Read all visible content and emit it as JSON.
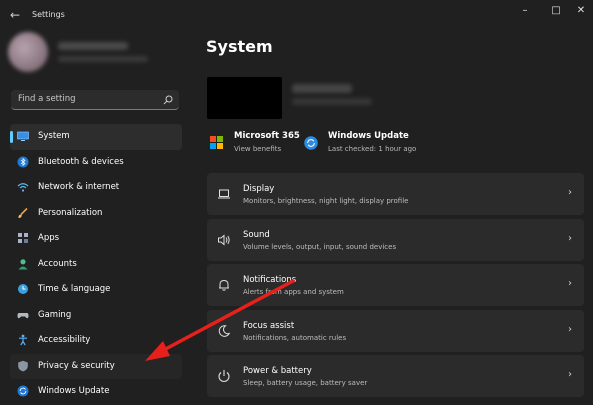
{
  "app": {
    "title": "Settings"
  },
  "search": {
    "placeholder": "Find a setting"
  },
  "sidebar": {
    "items": [
      {
        "label": "System"
      },
      {
        "label": "Bluetooth & devices"
      },
      {
        "label": "Network & internet"
      },
      {
        "label": "Personalization"
      },
      {
        "label": "Apps"
      },
      {
        "label": "Accounts"
      },
      {
        "label": "Time & language"
      },
      {
        "label": "Gaming"
      },
      {
        "label": "Accessibility"
      },
      {
        "label": "Privacy & security"
      },
      {
        "label": "Windows Update"
      }
    ]
  },
  "main": {
    "title": "System",
    "quick_links": [
      {
        "title": "Microsoft 365",
        "subtitle": "View benefits"
      },
      {
        "title": "Windows Update",
        "subtitle": "Last checked: 1 hour ago"
      }
    ],
    "cards": [
      {
        "title": "Display",
        "subtitle": "Monitors, brightness, night light, display profile"
      },
      {
        "title": "Sound",
        "subtitle": "Volume levels, output, input, sound devices"
      },
      {
        "title": "Notifications",
        "subtitle": "Alerts from apps and system"
      },
      {
        "title": "Focus assist",
        "subtitle": "Notifications, automatic rules"
      },
      {
        "title": "Power & battery",
        "subtitle": "Sleep, battery usage, battery saver"
      }
    ]
  },
  "colors": {
    "accent": "#60cdff",
    "annotation": "#e8201c",
    "background": "#202020",
    "card": "#2b2b2b"
  }
}
